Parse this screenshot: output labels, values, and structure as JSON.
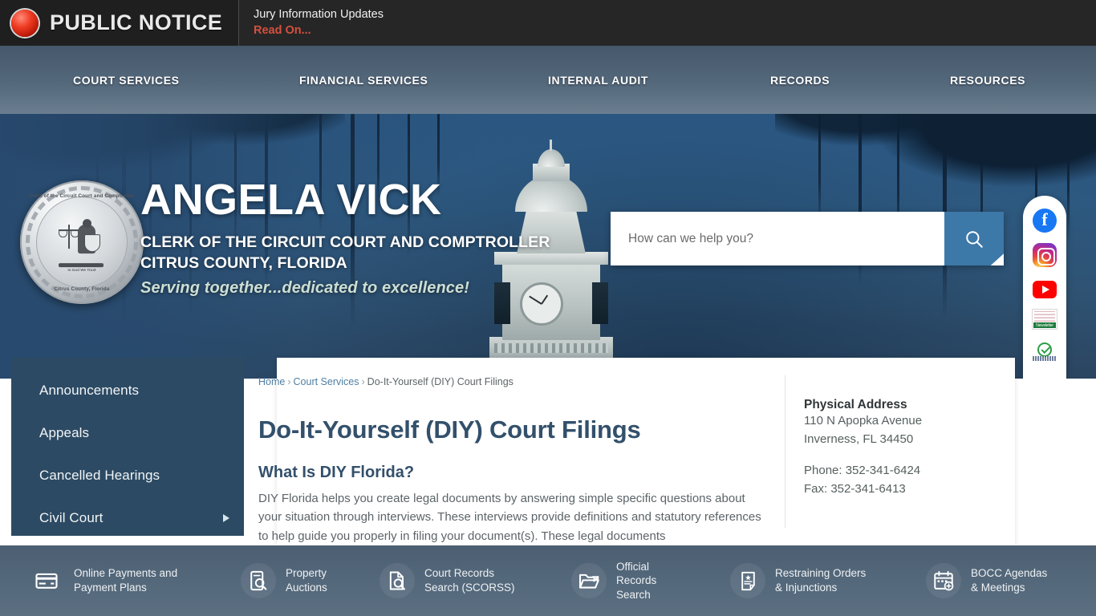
{
  "notice": {
    "label": "PUBLIC NOTICE",
    "headline": "Jury Information Updates",
    "read_on": "Read On..."
  },
  "mainnav": {
    "items": [
      {
        "label": "COURT SERVICES"
      },
      {
        "label": "FINANCIAL SERVICES"
      },
      {
        "label": "INTERNAL AUDIT"
      },
      {
        "label": "RECORDS"
      },
      {
        "label": "RESOURCES"
      }
    ]
  },
  "hero": {
    "name": "ANGELA VICK",
    "sub1": "CLERK OF THE CIRCUIT COURT AND COMPTROLLER",
    "sub2": "CITRUS COUNTY, FLORIDA",
    "tagline": "Serving together...dedicated to excellence!",
    "seal": {
      "top_text": "Clerk of the Circuit Court and Comptroller",
      "mid_text": "In God We Trust",
      "bottom_text": "Citrus County, Florida"
    }
  },
  "search": {
    "placeholder": "How can we help you?",
    "value": "",
    "button_icon": "search-icon"
  },
  "social": {
    "items": [
      {
        "name": "facebook-icon",
        "label": "Facebook",
        "glyph": "f"
      },
      {
        "name": "instagram-icon",
        "label": "Instagram"
      },
      {
        "name": "youtube-icon",
        "label": "YouTube"
      },
      {
        "name": "newsletter-badge-icon",
        "label": "Notify Me",
        "badge_text": "Newsletter"
      },
      {
        "name": "verified-check-badge-icon",
        "label": "Verified"
      }
    ]
  },
  "sidebar": {
    "items": [
      {
        "label": "Announcements",
        "has_submenu": false
      },
      {
        "label": "Appeals",
        "has_submenu": false
      },
      {
        "label": "Cancelled Hearings",
        "has_submenu": false
      },
      {
        "label": "Civil Court",
        "has_submenu": true
      }
    ]
  },
  "breadcrumb": {
    "home": "Home",
    "section": "Court Services",
    "current": "Do-It-Yourself (DIY) Court Filings",
    "separator": "›"
  },
  "main": {
    "title": "Do-It-Yourself (DIY) Court Filings",
    "section_heading": "What Is DIY Florida?",
    "paragraph": "DIY Florida helps you create legal documents by answering simple specific questions about your situation through interviews.  These interviews provide definitions and statutory references to help guide you properly in filing your document(s).  These legal documents"
  },
  "contact": {
    "heading": "Physical Address",
    "street": "110 N Apopka Avenue",
    "city_state_zip": "Inverness, FL 34450",
    "phone": "Phone: 352-341-6424",
    "fax": "Fax: 352-341-6413"
  },
  "quicklinks": {
    "items": [
      {
        "icon": "credit-card-icon",
        "label": "Online Payments and\nPayment Plans",
        "shaded": false
      },
      {
        "icon": "property-search-icon",
        "label": "Property\nAuctions",
        "shaded": true
      },
      {
        "icon": "court-records-icon",
        "label": "Court Records\nSearch (SCORSS)",
        "shaded": true
      },
      {
        "icon": "open-folder-icon",
        "label": "Official\nRecords\nSearch",
        "shaded": true
      },
      {
        "icon": "document-star-icon",
        "label": "Restraining Orders\n& Injunctions",
        "shaded": true
      },
      {
        "icon": "calendar-plus-icon",
        "label": "BOCC Agendas\n& Meetings",
        "shaded": true
      }
    ]
  },
  "colors": {
    "notice_bg": "#262626",
    "notice_accent": "#d4503f",
    "nav_bg": "#54687c",
    "hero_blue": "#2b4e70",
    "sidebar_bg": "#2c4a63",
    "heading_blue": "#33506b",
    "search_button": "#3c78a8",
    "quickbar_bg": "#54687b"
  }
}
